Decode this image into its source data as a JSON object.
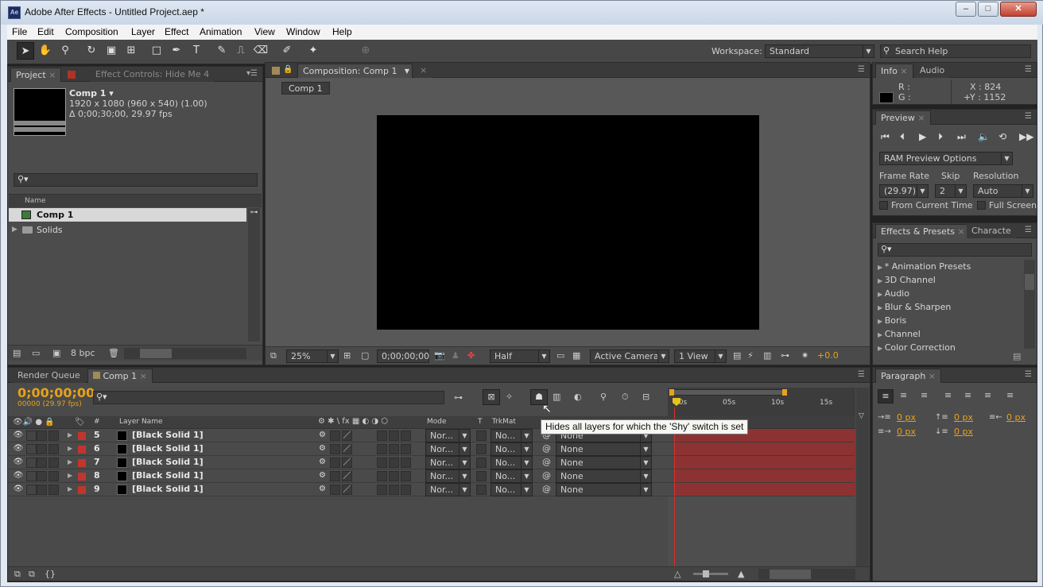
{
  "window": {
    "title": "Adobe After Effects - Untitled Project.aep *",
    "app_icon": "Ae"
  },
  "menu": [
    "File",
    "Edit",
    "Composition",
    "Layer",
    "Effect",
    "Animation",
    "View",
    "Window",
    "Help"
  ],
  "toolbar": {
    "workspace_label": "Workspace:",
    "workspace_value": "Standard",
    "search_placeholder": "Search Help"
  },
  "project": {
    "tabs": [
      "Project",
      "Effect Controls: Hide Me 4"
    ],
    "comp_name": "Comp 1 ▾",
    "comp_res": "1920 x 1080  (960 x 540) (1.00)",
    "comp_dur": "Δ 0;00;30;00, 29.97 fps",
    "col_name": "Name",
    "items": [
      {
        "label": "Comp 1",
        "type": "comp"
      },
      {
        "label": "Solids",
        "type": "folder"
      }
    ],
    "bpc": "8 bpc"
  },
  "composition": {
    "tab": "Composition: Comp 1",
    "breadcrumb": "Comp 1",
    "zoom": "25%",
    "timecode": "0;00;00;00",
    "resolution": "Half",
    "camera": "Active Camera",
    "views": "1 View",
    "exposure": "+0.0"
  },
  "info": {
    "tabs": [
      "Info",
      "Audio"
    ],
    "r": "R :",
    "g": "G :",
    "x": "X : 824",
    "y": "Y : 1152"
  },
  "preview": {
    "tab": "Preview",
    "ram_options": "RAM Preview Options",
    "frame_rate_label": "Frame Rate",
    "skip_label": "Skip",
    "resolution_label": "Resolution",
    "frame_rate": "(29.97)",
    "skip": "2",
    "resolution": "Auto",
    "from_current": "From Current Time",
    "full_screen": "Full Screen"
  },
  "effects": {
    "tabs": [
      "Effects & Presets",
      "Characte"
    ],
    "items": [
      "* Animation Presets",
      "3D Channel",
      "Audio",
      "Blur & Sharpen",
      "Boris",
      "Channel",
      "Color Correction"
    ]
  },
  "paragraph": {
    "tab": "Paragraph",
    "values": [
      "0 px",
      "0 px",
      "0 px",
      "0 px",
      "0 px"
    ]
  },
  "timeline": {
    "tabs": [
      "Render Queue",
      "Comp 1"
    ],
    "timecode": "0;00;00;00",
    "frames": "00000 (29.97 fps)",
    "col_layer_name": "Layer Name",
    "col_num": "#",
    "col_mode": "Mode",
    "col_t": "T",
    "col_trkmat": "TrkMat",
    "ruler": [
      "00s",
      "05s",
      "10s",
      "15s"
    ],
    "tooltip": "Hides all layers for which the 'Shy' switch is set",
    "layers": [
      {
        "num": "5",
        "name": "[Black Solid 1]",
        "mode": "Nor...",
        "trkmat": "No...",
        "parent": "None"
      },
      {
        "num": "6",
        "name": "[Black Solid 1]",
        "mode": "Nor...",
        "trkmat": "No...",
        "parent": "None"
      },
      {
        "num": "7",
        "name": "[Black Solid 1]",
        "mode": "Nor...",
        "trkmat": "No...",
        "parent": "None"
      },
      {
        "num": "8",
        "name": "[Black Solid 1]",
        "mode": "Nor...",
        "trkmat": "No...",
        "parent": "None"
      },
      {
        "num": "9",
        "name": "[Black Solid 1]",
        "mode": "Nor...",
        "trkmat": "No...",
        "parent": "None"
      }
    ]
  },
  "colors": {
    "accent": "#e8a11a",
    "bar": "#8d3232",
    "label_red": "#c0362c"
  }
}
